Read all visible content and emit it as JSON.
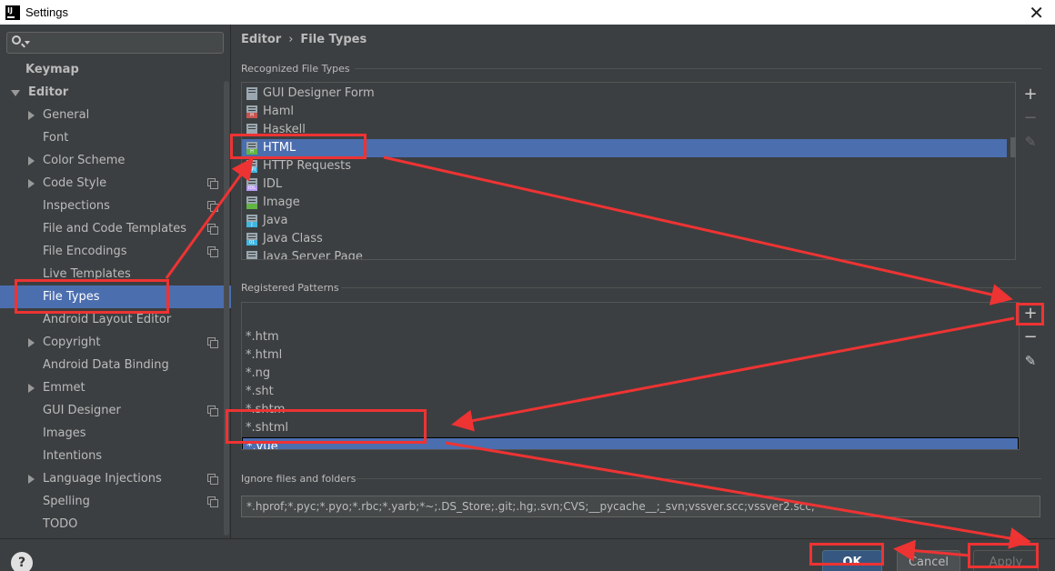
{
  "window": {
    "title": "Settings",
    "close_glyph": "✕"
  },
  "search": {
    "placeholder": ""
  },
  "sidebar": {
    "items": [
      {
        "label": "Keymap",
        "level": 0,
        "bold": true
      },
      {
        "label": "Editor",
        "level": 0,
        "bold": true,
        "expanded": true
      },
      {
        "label": "General",
        "level": 1,
        "expandable": true
      },
      {
        "label": "Font",
        "level": 1
      },
      {
        "label": "Color Scheme",
        "level": 1,
        "expandable": true
      },
      {
        "label": "Code Style",
        "level": 1,
        "expandable": true,
        "copy": true
      },
      {
        "label": "Inspections",
        "level": 1,
        "copy": true
      },
      {
        "label": "File and Code Templates",
        "level": 1,
        "copy": true
      },
      {
        "label": "File Encodings",
        "level": 1,
        "copy": true
      },
      {
        "label": "Live Templates",
        "level": 1
      },
      {
        "label": "File Types",
        "level": 1,
        "selected": true
      },
      {
        "label": "Android Layout Editor",
        "level": 1
      },
      {
        "label": "Copyright",
        "level": 1,
        "expandable": true,
        "copy": true
      },
      {
        "label": "Android Data Binding",
        "level": 1
      },
      {
        "label": "Emmet",
        "level": 1,
        "expandable": true
      },
      {
        "label": "GUI Designer",
        "level": 1,
        "copy": true
      },
      {
        "label": "Images",
        "level": 1
      },
      {
        "label": "Intentions",
        "level": 1
      },
      {
        "label": "Language Injections",
        "level": 1,
        "expandable": true,
        "copy": true
      },
      {
        "label": "Spelling",
        "level": 1,
        "copy": true
      },
      {
        "label": "TODO",
        "level": 1
      }
    ]
  },
  "breadcrumb": {
    "parent": "Editor",
    "separator": "›",
    "current": "File Types"
  },
  "recognized": {
    "title": "Recognized File Types",
    "items": [
      {
        "name": "GUI Designer Form",
        "tag": "",
        "color": "#9aa7b0"
      },
      {
        "name": "Haml",
        "tag": "H",
        "color": "#c75450"
      },
      {
        "name": "Haskell",
        "tag": "",
        "color": "#9aa7b0"
      },
      {
        "name": "HTML",
        "tag": "H",
        "color": "#62b543",
        "selected": true
      },
      {
        "name": "HTTP Requests",
        "tag": "API",
        "color": "#40b6e0"
      },
      {
        "name": "IDL",
        "tag": "IDL",
        "color": "#b99bf8"
      },
      {
        "name": "Image",
        "tag": "",
        "color": "#62b543"
      },
      {
        "name": "Java",
        "tag": "J",
        "color": "#40b6e0"
      },
      {
        "name": "Java Class",
        "tag": "01",
        "color": "#40b6e0"
      },
      {
        "name": "Java Server Page",
        "tag": "",
        "color": "#9aa7b0"
      }
    ]
  },
  "patterns": {
    "title": "Registered Patterns",
    "items": [
      {
        "name": "*.htm"
      },
      {
        "name": "*.html"
      },
      {
        "name": "*.ng"
      },
      {
        "name": "*.sht"
      },
      {
        "name": "*.shtm"
      },
      {
        "name": "*.shtml"
      },
      {
        "name": "*.vue",
        "selected": true
      }
    ]
  },
  "tools": {
    "add": "+",
    "remove": "−",
    "edit": "✎"
  },
  "ignore": {
    "title": "Ignore files and folders",
    "value": "*.hprof;*.pyc;*.pyo;*.rbc;*.yarb;*~;.DS_Store;.git;.hg;.svn;CVS;__pycache__;_svn;vssver.scc;vssver2.scc;"
  },
  "buttons": {
    "help": "?",
    "ok": "OK",
    "cancel": "Cancel",
    "apply": "Apply"
  },
  "colors": {
    "selection": "#4b6eaf",
    "annotation": "#ee3333",
    "background": "#3c3f41"
  }
}
